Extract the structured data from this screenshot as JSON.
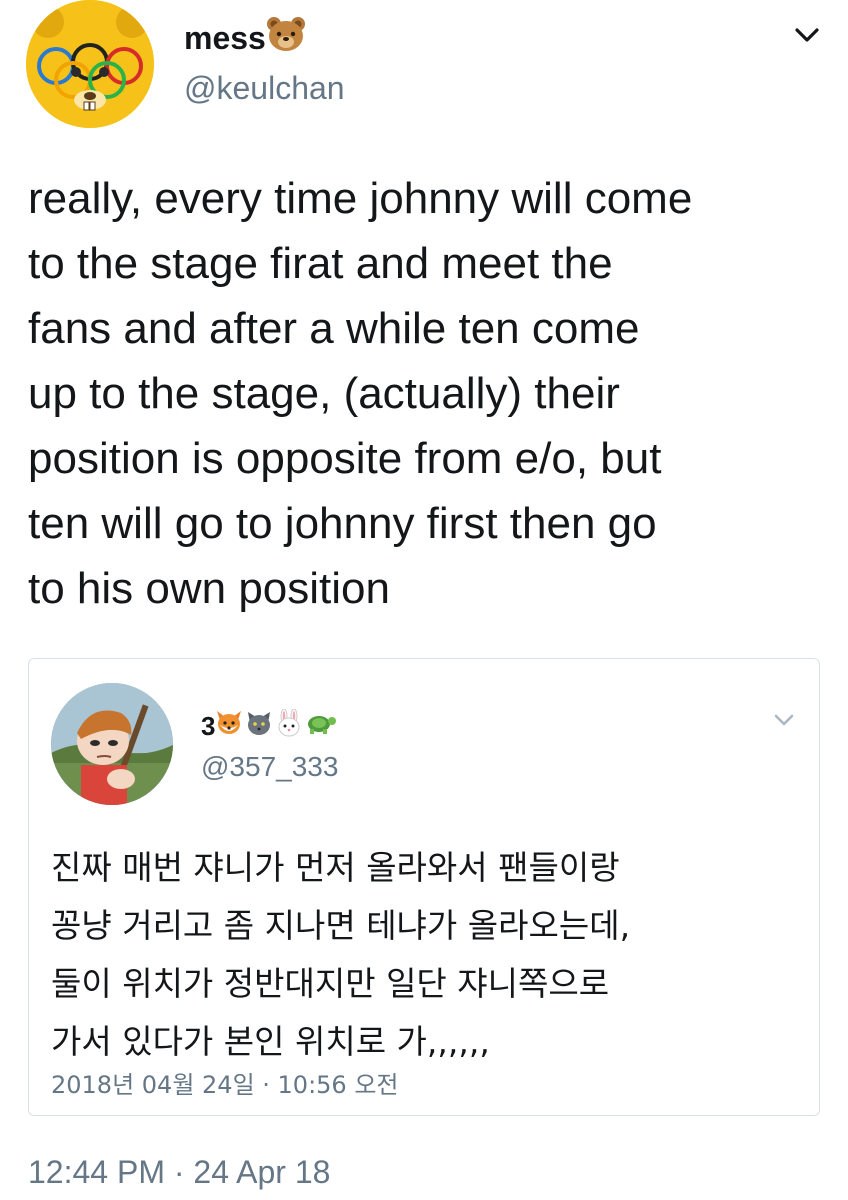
{
  "author": {
    "display_name": "mess",
    "display_emoji": "bear-face-icon",
    "handle": "@keulchan"
  },
  "tweet": {
    "lines": [
      "really, every time johnny will come",
      "to the stage firat and meet the",
      "fans and after a while ten come",
      "up to the stage, (actually) their",
      "position is opposite from e/o, but",
      "ten will go to johnny first then go",
      "to his own position"
    ],
    "timestamp": "12:44 PM · 24 Apr 18"
  },
  "quoted": {
    "display_name": "3",
    "display_emojis": [
      "fox-face-icon",
      "cat-face-icon",
      "rabbit-face-icon",
      "turtle-icon"
    ],
    "handle": "@357_333",
    "lines": [
      "진짜 매번 쟈니가 먼저 올라와서 팬들이랑",
      "꽁냥 거리고 좀 지나면 테냐가 올라오는데,",
      "둘이 위치가 정반대지만 일단 쟈니쪽으로",
      "가서 있다가 본인 위치로 가,,,,,,"
    ],
    "timestamp": "2018년 04월 24일 · 10:56 오전"
  },
  "colors": {
    "text": "#14171a",
    "secondary": "#657786",
    "border": "#d9e1e7",
    "avatar_yellow": "#f6c21a"
  }
}
